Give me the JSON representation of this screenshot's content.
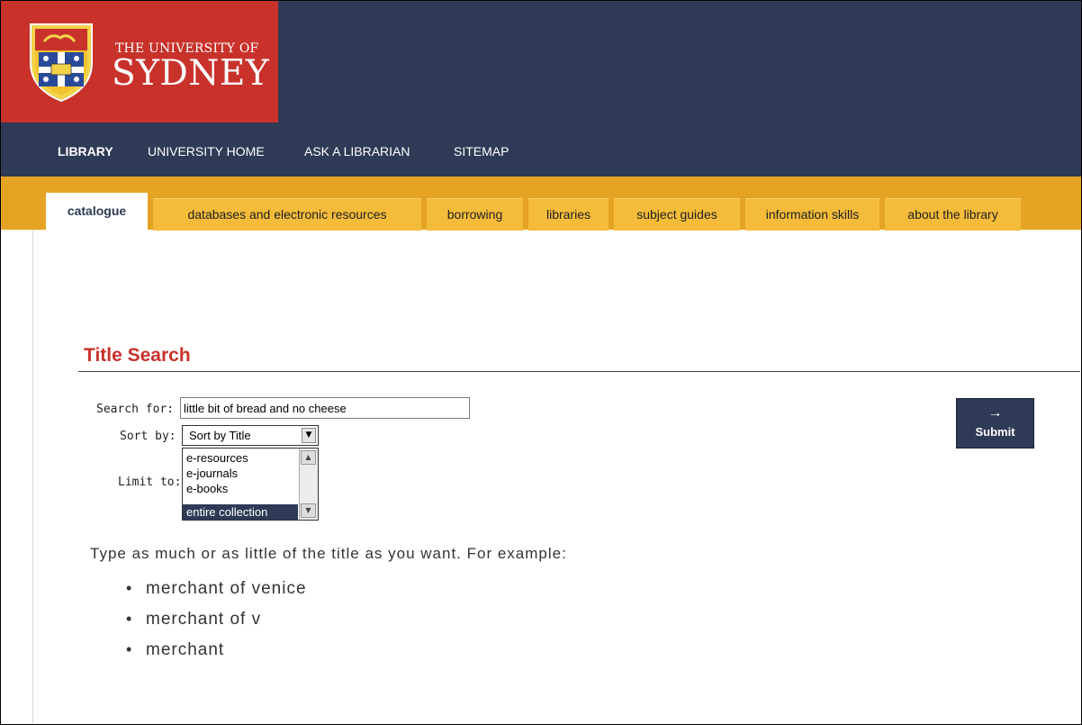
{
  "logo": {
    "line1": "THE UNIVERSITY OF",
    "line2": "SYDNEY"
  },
  "topnav": [
    {
      "label": "LIBRARY"
    },
    {
      "label": "UNIVERSITY HOME"
    },
    {
      "label": "ASK A LIBRARIAN"
    },
    {
      "label": "SITEMAP"
    }
  ],
  "tabs": [
    {
      "label": "catalogue",
      "active": true
    },
    {
      "label": "databases and electronic resources"
    },
    {
      "label": "borrowing"
    },
    {
      "label": "libraries"
    },
    {
      "label": "subject guides"
    },
    {
      "label": "information skills"
    },
    {
      "label": "about the library"
    }
  ],
  "search": {
    "title": "Title Search",
    "search_for_label": "Search for:",
    "search_value": "little bit of bread and no cheese",
    "sort_by_label": "Sort by:",
    "sort_value": "Sort by Title",
    "limit_to_label": "Limit to:",
    "limit_options": [
      "e-resources",
      "e-journals",
      "e-books",
      "entire collection"
    ],
    "limit_selected": "entire collection",
    "submit_label": "Submit",
    "submit_arrow": "→"
  },
  "help": {
    "hint": "Type as much or as little of the title as you want. For example:",
    "examples": [
      "merchant of venice",
      "merchant of v",
      "merchant"
    ]
  },
  "colors": {
    "navy": "#2e3a56",
    "red": "#c8322b",
    "gold": "#e5a323",
    "tab": "#f4bc3a"
  }
}
